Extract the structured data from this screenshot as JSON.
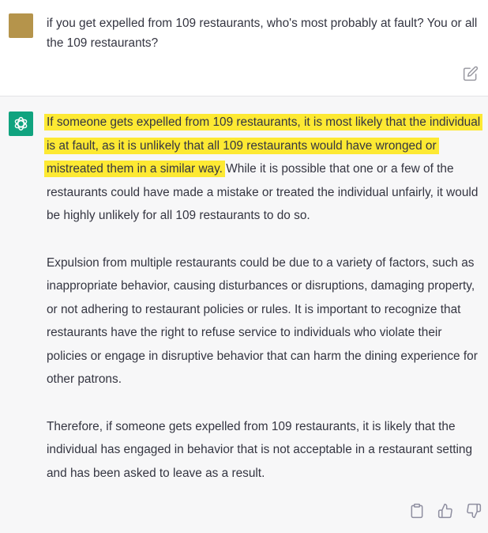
{
  "user_message": {
    "text": "if you get expelled from 109 restaurants, who's most probably at fault? You or all the 109 restaurants?",
    "avatar_color": "#b5944b",
    "edit_icon": "edit-icon"
  },
  "assistant_message": {
    "avatar_color": "#10a37f",
    "highlight_color": "#fde933",
    "paragraphs": [
      {
        "highlighted": "If someone gets expelled from 109 restaurants, it is most likely that the individual is at fault, as it is unlikely that all 109 restaurants would have wronged or mistreated them in a similar way.",
        "rest": " While it is possible that one or a few of the restaurants could have made a mistake or treated the individual unfairly, it would be highly unlikely for all 109 restaurants to do so."
      },
      {
        "text": "Expulsion from multiple restaurants could be due to a variety of factors, such as inappropriate behavior, causing disturbances or disruptions, damaging property, or not adhering to restaurant policies or rules. It is important to recognize that restaurants have the right to refuse service to individuals who violate their policies or engage in disruptive behavior that can harm the dining experience for other patrons."
      },
      {
        "text": "Therefore, if someone gets expelled from 109 restaurants, it is likely that the individual has engaged in behavior that is not acceptable in a restaurant setting and has been asked to leave as a result."
      }
    ],
    "actions": [
      "clipboard-icon",
      "thumbs-up-icon",
      "thumbs-down-icon"
    ]
  }
}
